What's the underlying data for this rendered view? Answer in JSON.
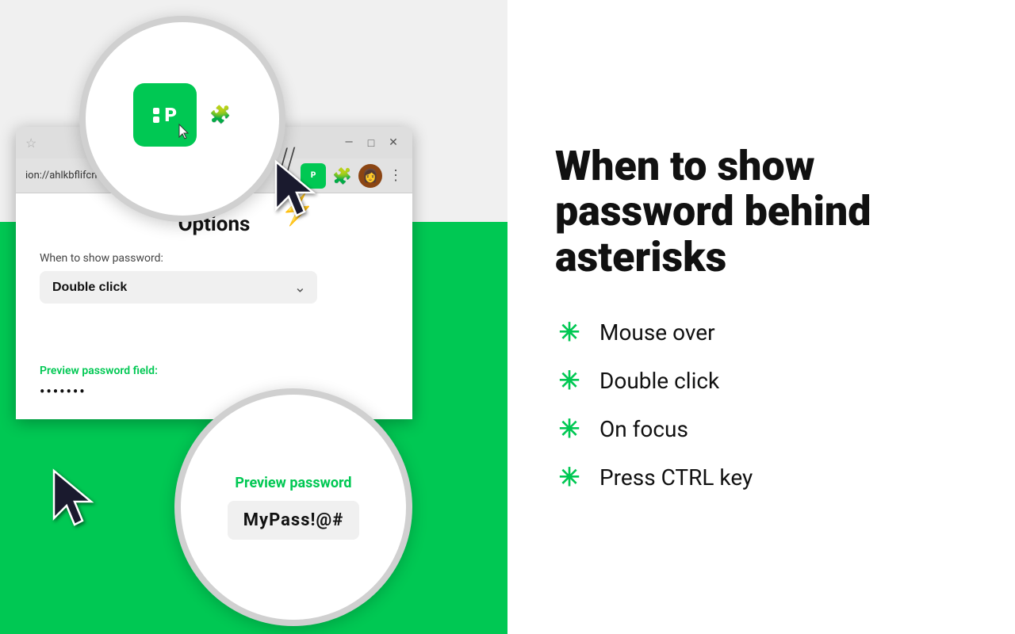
{
  "left": {
    "browser": {
      "address": "ion://ahlkbflifcnfejklnpbg",
      "ext_label": "P",
      "min_btn": "—",
      "max_btn": "□",
      "close_btn": "✕"
    },
    "options": {
      "title": "Options",
      "label": "When to show password:",
      "dropdown_value": "Double click",
      "dropdown_arrow": "⌄"
    },
    "preview": {
      "label": "Preview password field:",
      "password_masked": "•••••••",
      "preview_label_big": "Preview password",
      "password_revealed": "MyPass!@#"
    }
  },
  "right": {
    "title": "When to show password behind asterisks",
    "features": [
      {
        "bullet": "✳",
        "text": "Mouse over"
      },
      {
        "bullet": "✳",
        "text": "Double click"
      },
      {
        "bullet": "✳",
        "text": "On focus"
      },
      {
        "bullet": "✳",
        "text": "Press CTRL key"
      }
    ]
  }
}
